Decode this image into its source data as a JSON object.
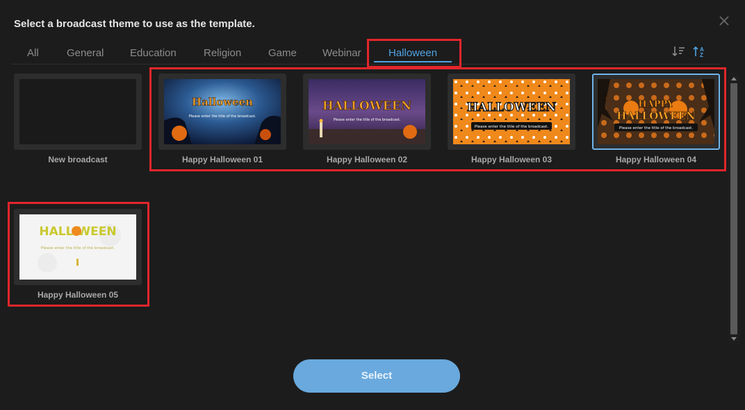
{
  "dialog": {
    "title": "Select a broadcast theme to use as the template."
  },
  "tabs": [
    {
      "label": "All"
    },
    {
      "label": "General"
    },
    {
      "label": "Education"
    },
    {
      "label": "Religion"
    },
    {
      "label": "Game"
    },
    {
      "label": "Webinar"
    },
    {
      "label": "Halloween",
      "active": true
    }
  ],
  "sort": {
    "desc_icon": "sort-descending-icon",
    "asc_icon": "sort-ascending-az-icon"
  },
  "cards": [
    {
      "label": "New broadcast"
    },
    {
      "label": "Happy Halloween 01",
      "thumb_title": "Halloween",
      "thumb_caption": "Please enter the title of the broadcast."
    },
    {
      "label": "Happy Halloween 02",
      "thumb_title": "HALLOWEEN",
      "thumb_caption": "Please enter the title of the broadcast."
    },
    {
      "label": "Happy Halloween 03",
      "thumb_title": "HALLOWEEN",
      "thumb_caption": "Please enter the title of the broadcast."
    },
    {
      "label": "Happy Halloween 04",
      "thumb_title_top": "HAPPY",
      "thumb_title": "HALLOWEEN",
      "thumb_caption": "Please enter the title of the broadcast.",
      "selected": true
    },
    {
      "label": "Happy Halloween 05",
      "thumb_title": "HALL WEEN",
      "thumb_caption": "Please enter the title of the broadcast."
    }
  ],
  "select_button": {
    "label": "Select"
  },
  "colors": {
    "accent": "#4fa3e3",
    "highlight": "#e2262b",
    "button": "#69a9dd"
  }
}
